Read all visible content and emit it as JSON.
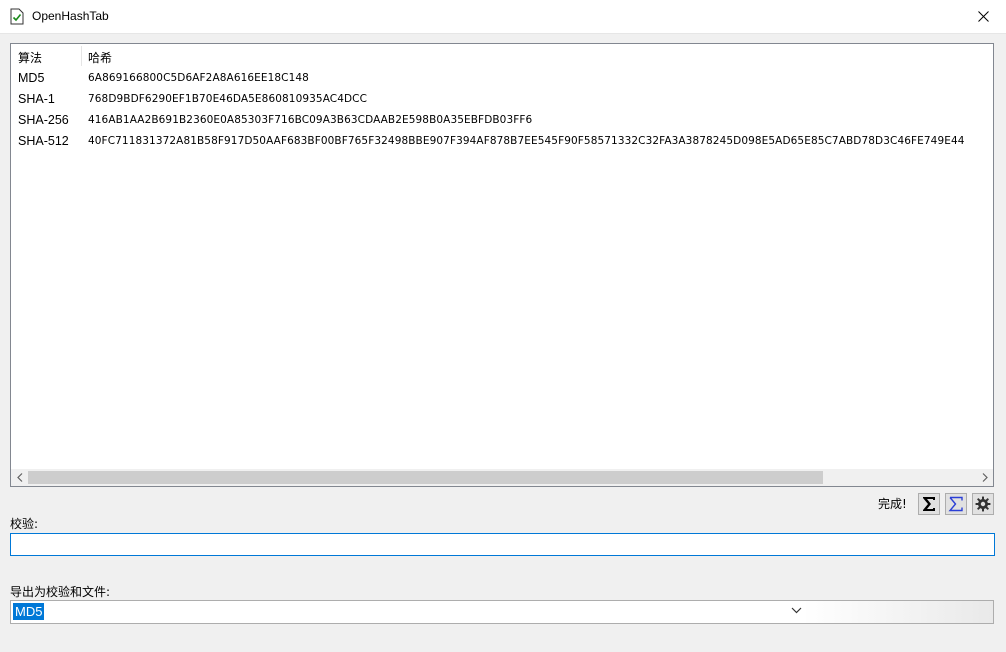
{
  "window": {
    "title": "OpenHashTab"
  },
  "list": {
    "columns": {
      "algorithm": "算法",
      "hash": "哈希"
    },
    "rows": [
      {
        "algorithm": "MD5",
        "hash": "6A869166800C5D6AF2A8A616EE18C148"
      },
      {
        "algorithm": "SHA-1",
        "hash": "768D9BDF6290EF1B70E46DA5E860810935AC4DCC"
      },
      {
        "algorithm": "SHA-256",
        "hash": "416AB1AA2B691B2360E0A85303F716BC09A3B63CDAAB2E598B0A35EBFDB03FF6"
      },
      {
        "algorithm": "SHA-512",
        "hash": "40FC711831372A81B58F917D50AAF683BF00BF765F32498BBE907F394AF878B7EE545F90F58571332C32FA3A3878245D098E5AD65E85C7ABD78D3C46FE749E44"
      }
    ]
  },
  "status": {
    "text": "完成!"
  },
  "toolbar": {
    "sum_icon": "sigma-icon",
    "sum_outline_icon": "sigma-outline-icon",
    "settings_icon": "gear-icon"
  },
  "check": {
    "label": "校验:",
    "value": ""
  },
  "export": {
    "label": "导出为校验和文件:",
    "selected": "MD5"
  },
  "colors": {
    "accent": "#0078d7",
    "scroll_thumb": "#cdcdcd"
  }
}
